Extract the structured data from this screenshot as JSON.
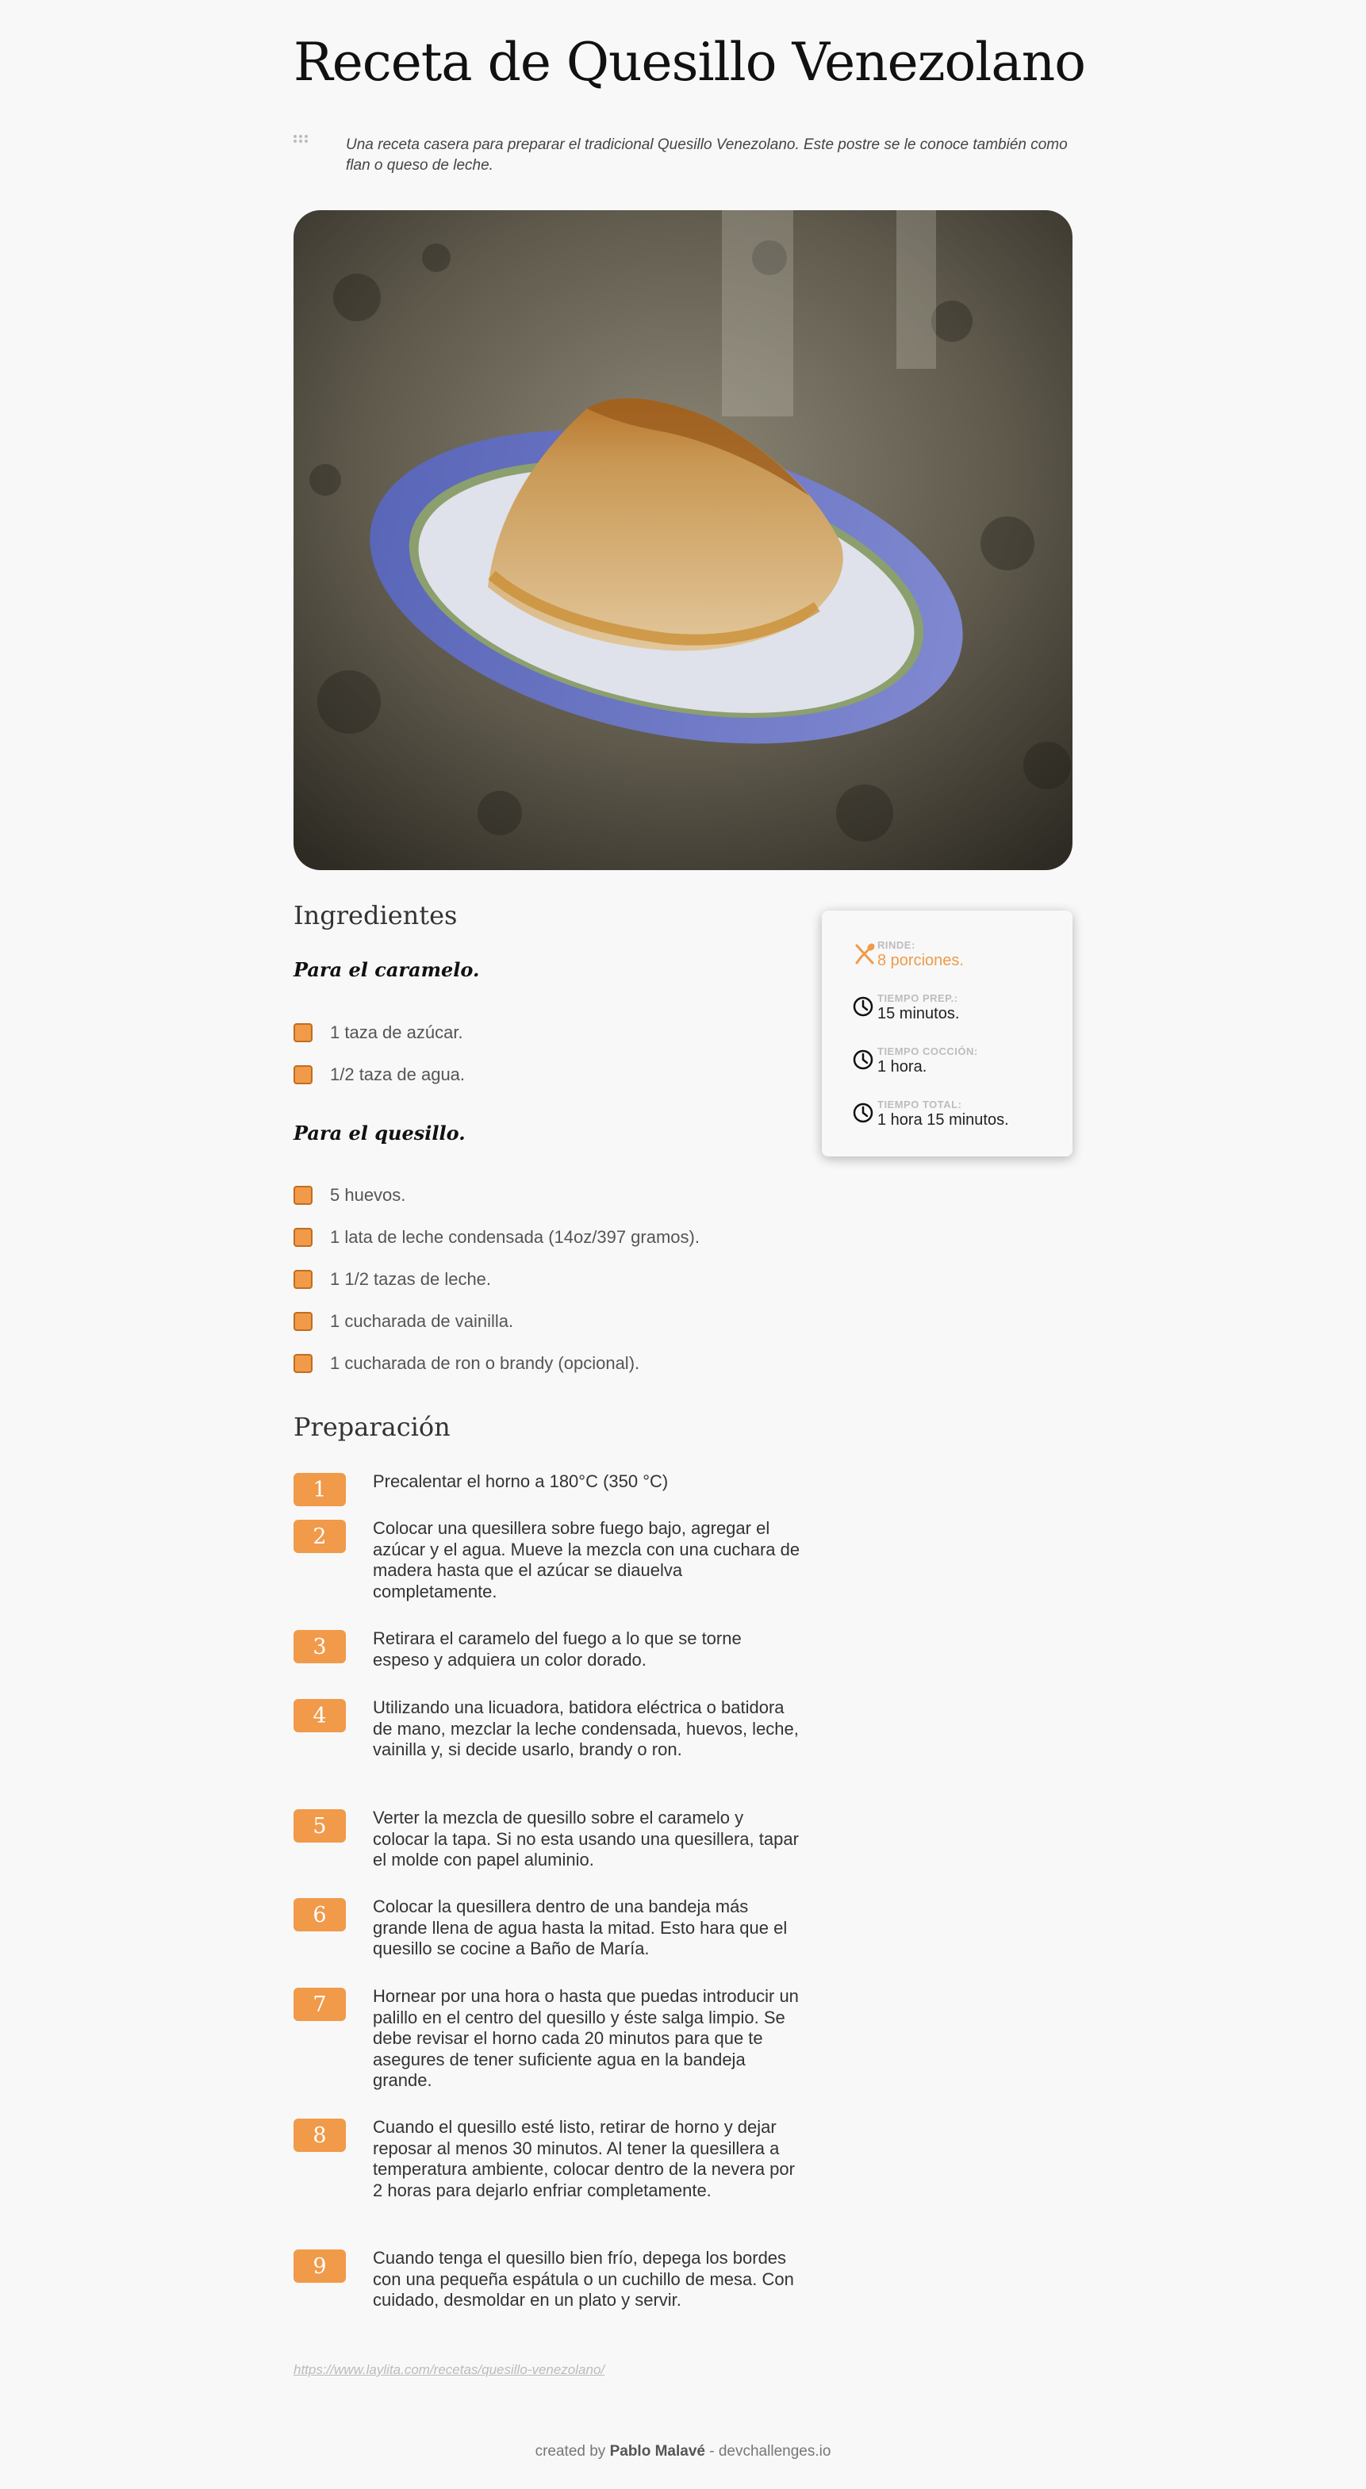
{
  "page": {
    "title": "Receta de Quesillo Venezolano",
    "intro": "Una receta casera para preparar el tradicional Quesillo Venezolano. Este postre se le conoce también como flan o queso de leche."
  },
  "hero_image": {
    "description_icon": "photo-of-quesillo-on-plate"
  },
  "ingredients": {
    "heading": "Ingredientes",
    "groups": [
      {
        "title": "Para el caramelo.",
        "items": [
          "1 taza de azúcar.",
          "1/2 taza de agua."
        ]
      },
      {
        "title": "Para el quesillo.",
        "items": [
          "5 huevos.",
          "1 lata de leche condensada (14oz/397 gramos).",
          "1 1/2 tazas de leche.",
          "1 cucharada de vainilla.",
          "1 cucharada de ron o brandy (opcional)."
        ]
      }
    ]
  },
  "info_card": {
    "rows": [
      {
        "icon": "fork-spoon-icon",
        "label": "RINDE:",
        "value": "8 porciones."
      },
      {
        "icon": "clock-icon",
        "label": "TIEMPO PREP.:",
        "value": "15 minutos."
      },
      {
        "icon": "clock-icon",
        "label": "TIEMPO COCCIÓN:",
        "value": "1 hora."
      },
      {
        "icon": "clock-icon",
        "label": "TIEMPO TOTAL:",
        "value": "1 hora 15 minutos."
      }
    ]
  },
  "preparation": {
    "heading": "Preparación",
    "steps": [
      {
        "n": "1",
        "text": "Precalentar el horno a 180°C (350 °C)"
      },
      {
        "n": "2",
        "text": "Colocar una quesillera sobre fuego bajo, agregar el azúcar y el agua. Mueve la mezcla con una cuchara de madera hasta que el azúcar se diauelva completamente."
      },
      {
        "n": "3",
        "text": "Retirara el caramelo del fuego a lo que se torne espeso y adquiera un color dorado."
      },
      {
        "n": "4",
        "text": "Utilizando una licuadora, batidora eléctrica o batidora de mano, mezclar la leche condensada, huevos, leche, vainilla y, si decide usarlo, brandy o ron."
      },
      {
        "n": "5",
        "text": "Verter la mezcla de quesillo sobre el caramelo y colocar la tapa. Si no esta usando una quesillera, tapar el molde con papel aluminio."
      },
      {
        "n": "6",
        "text": "Colocar la quesillera dentro de una bandeja más grande llena de agua hasta la mitad. Esto hara que el quesillo se cocine a Baño de María."
      },
      {
        "n": "7",
        "text": "Hornear por una hora o hasta que puedas introducir un palillo en el centro del quesillo y éste salga limpio. Se debe revisar el horno cada 20 minutos para que te asegures de tener suficiente agua en la bandeja grande."
      },
      {
        "n": "8",
        "text": "Cuando el quesillo esté listo, retirar de horno y dejar reposar al menos 30 minutos. Al tener la quesillera a temperatura ambiente, colocar dentro de la nevera por 2 horas para dejarlo enfriar completamente."
      },
      {
        "n": "9",
        "text": "Cuando tenga el quesillo bien frío, depega los bordes con una pequeña espátula o un cuchillo de mesa. Con cuidado, desmoldar en un plato y servir."
      }
    ]
  },
  "source_link": "https://www.laylita.com/recetas/quesillo-venezolano/",
  "footer": {
    "prefix": "created by",
    "author": "Pablo Malavé",
    "sep": " - ",
    "site": "devchallenges.io"
  },
  "colors": {
    "accent": "#f09a4a",
    "background": "#f8f8f8",
    "text": "#333333"
  }
}
